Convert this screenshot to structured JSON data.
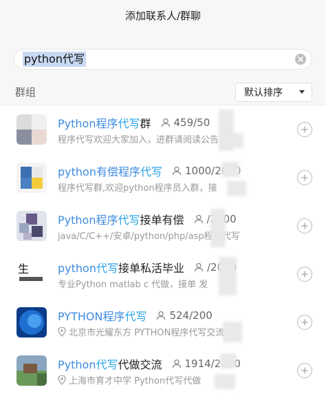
{
  "window": {
    "title": "添加联系人/群聊"
  },
  "search": {
    "query": "python代写"
  },
  "toolbar": {
    "tab_label": "群组",
    "sort_label": "默认排序"
  },
  "results": [
    {
      "name_prefix": "Python程序",
      "name_highlight": "代写",
      "name_suffix": "群",
      "count": "459/50",
      "desc": "程序代写欢迎大家加入，进群请阅读公告，",
      "avatar_colors": [
        "#d9d9d9",
        "#8a8fa0",
        "#e8d9d2",
        "#b9c7d9"
      ]
    },
    {
      "name_prefix": "python有偿程序",
      "name_highlight": "代写",
      "name_suffix": "",
      "count": "1000/2000",
      "desc": "程序代写群,欢迎python程序员入群，接",
      "avatar_colors": [
        "#3e6fb0",
        "#f2cc3a",
        "#4a7fc1",
        "#f4d95a"
      ]
    },
    {
      "name_prefix": "Python程序",
      "name_highlight": "代写",
      "name_suffix": "接单有偿",
      "count": "/2000",
      "desc": "java/C/C++/安卓/python/php/asp程序代写",
      "avatar_colors": [
        "#6a5a8a",
        "#d0d0d8",
        "#4a4a6a",
        "#9aa6c0"
      ]
    },
    {
      "name_prefix": "python",
      "name_highlight": "代写",
      "name_suffix": "接单私活毕业",
      "count": "/2000",
      "desc": "专业Python matlab c 代做，接单 发",
      "avatar_colors": [
        "#ffffff",
        "#111111",
        "#dddddd",
        "#ffffff"
      ]
    },
    {
      "name_prefix": "PYTHON程序",
      "name_highlight": "代写",
      "name_suffix": "",
      "count": "524/200",
      "desc": "北京市光耀东方  PYTHON程序代写交流群",
      "has_location": true,
      "avatar_colors": [
        "#1f6fd0",
        "#0a3c8a",
        "#4aa0f0",
        "#1858b0"
      ]
    },
    {
      "name_prefix": "Python",
      "name_highlight": "代写",
      "name_suffix": "代做交流",
      "count": "1914/2000",
      "desc": "上海市育才中学  Python代写代做",
      "has_location": true,
      "avatar_colors": [
        "#6a9a5a",
        "#8aa6c0",
        "#4a7040",
        "#b0c0a0"
      ]
    }
  ]
}
